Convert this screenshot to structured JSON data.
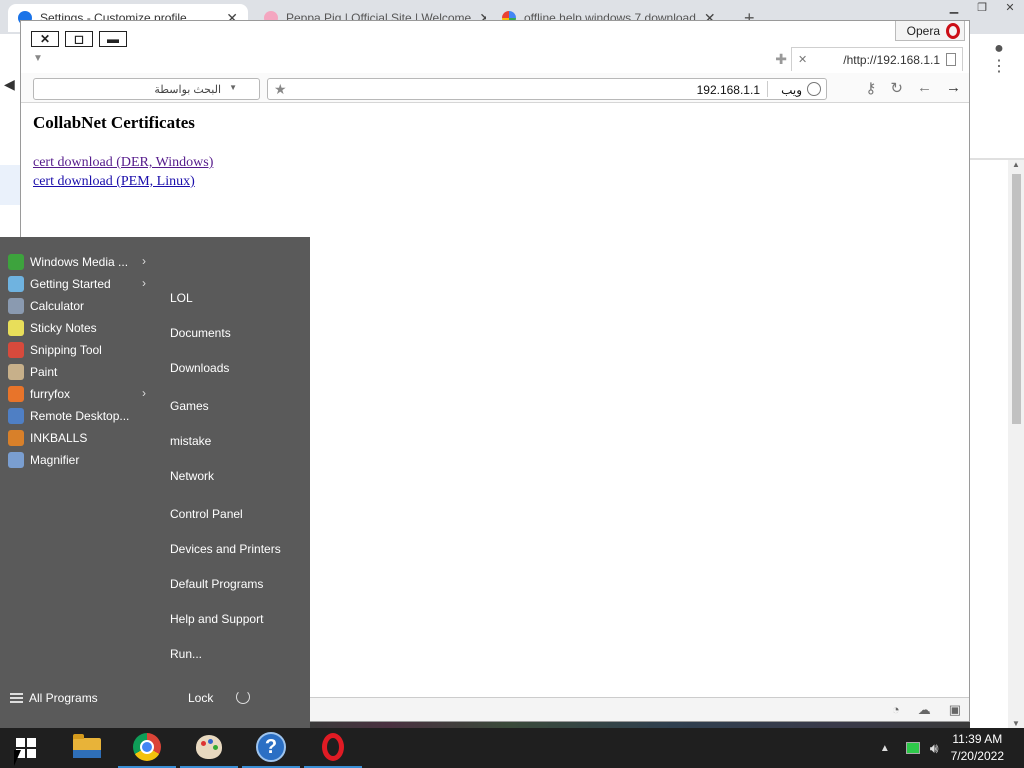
{
  "chrome": {
    "tabs": [
      {
        "title": "Settings - Customize profile"
      },
      {
        "title": "Peppa Pig | Official Site | Welcome"
      },
      {
        "title": "offline help windows 7 download"
      }
    ],
    "new_tab": "+",
    "close_glyph": "✕"
  },
  "opera": {
    "brand": "Opera",
    "tab_title": "/http://192.168.1.1",
    "search_label": "البحث بواسطة",
    "address_url": "192.168.1.1",
    "address_web_label": "ويب",
    "page": {
      "title": "CollabNet Certificates",
      "links": [
        "cert download (DER, Windows)",
        "cert download (PEM, Linux)"
      ]
    }
  },
  "start_menu": {
    "programs": [
      {
        "label": "Windows Media ...",
        "has_submenu": true,
        "color": "#3da33d"
      },
      {
        "label": "Getting Started",
        "has_submenu": true,
        "color": "#6fb3e0"
      },
      {
        "label": "Calculator",
        "has_submenu": false,
        "color": "#8a9ab0"
      },
      {
        "label": "Sticky Notes",
        "has_submenu": false,
        "color": "#e8de5a"
      },
      {
        "label": "Snipping Tool",
        "has_submenu": false,
        "color": "#d74a3c"
      },
      {
        "label": "Paint",
        "has_submenu": false,
        "color": "#c7b08a"
      },
      {
        "label": "furryfox",
        "has_submenu": true,
        "color": "#e8742a"
      },
      {
        "label": "Remote Desktop...",
        "has_submenu": false,
        "color": "#4f7fc4"
      },
      {
        "label": "INKBALLS",
        "has_submenu": false,
        "color": "#d8802a"
      },
      {
        "label": "Magnifier",
        "has_submenu": false,
        "color": "#7a9ed0"
      }
    ],
    "places": [
      "LOL",
      "Documents",
      "Downloads",
      "Games",
      "mistake",
      "Network",
      "Control Panel",
      "Devices and Printers",
      "Default Programs",
      "Help and Support",
      "Run..."
    ],
    "all_programs": "All Programs",
    "lock": "Lock"
  },
  "taskbar": {
    "time": "11:39 AM",
    "date": "7/20/2022"
  }
}
